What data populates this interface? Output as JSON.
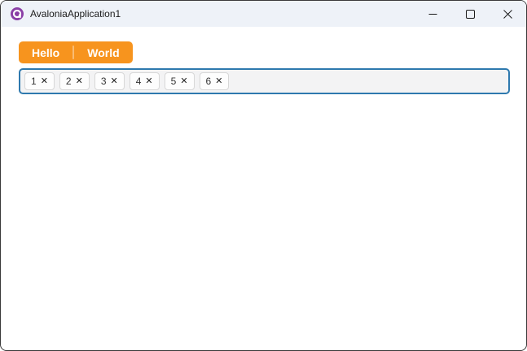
{
  "window": {
    "title": "AvaloniaApplication1",
    "app_icon": "avalonia-logo",
    "controls": {
      "minimize": "minimize",
      "maximize": "maximize",
      "close": "close"
    }
  },
  "toolbar": {
    "buttons": [
      {
        "label": "Hello"
      },
      {
        "label": "World"
      }
    ]
  },
  "tags_field": {
    "items": [
      {
        "label": "1"
      },
      {
        "label": "2"
      },
      {
        "label": "3"
      },
      {
        "label": "4"
      },
      {
        "label": "5"
      },
      {
        "label": "6"
      }
    ],
    "remove_icon": "✕"
  },
  "colors": {
    "button_orange": "#F7941E",
    "field_border_blue": "#2E79AE",
    "titlebar_bg": "#EEF2F8",
    "window_border": "#3A3A3A",
    "logo_purple": "#8A3FA6"
  }
}
